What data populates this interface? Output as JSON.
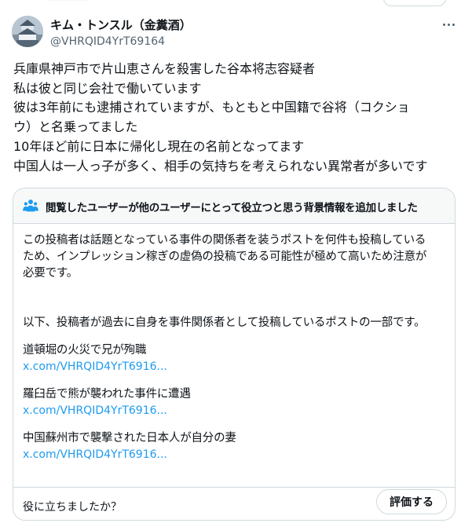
{
  "author": {
    "display_name": "キム・トンスル（金糞酒）",
    "handle": "@VHRQID4YrT69164"
  },
  "tweet": {
    "lines": [
      "兵庫県神戸市で片山恵さんを殺害した谷本将志容疑者",
      "私は彼と同じ会社で働いています",
      "彼は3年前にも逮捕されていますが、もともと中国籍で谷将（コクショ",
      "ウ）と名乗ってました",
      "10年ほど前に日本に帰化し現在の名前となってます",
      "中国人は一人っ子が多く、相手の気持ちを考えられない異常者が多いです"
    ]
  },
  "community_note": {
    "header": "閲覧したユーザーが他のユーザーにとって役立つと思う背景情報を追加しました",
    "body_lines": [
      "この投稿者は話題となっている事件の関係者を装うポストを何件も投稿している",
      "ため、インプレッション稼ぎの虚偽の投稿である可能性が極めて高いため注意が",
      "必要です。"
    ],
    "intro": "以下、投稿者が過去に自身を事件関係者として投稿しているポストの一部です。",
    "examples": [
      {
        "text": "道頓堀の火災で兄が殉職",
        "link": "x.com/VHRQID4YrT6916..."
      },
      {
        "text": "羅臼岳で熊が襲われた事件に遭遇",
        "link": "x.com/VHRQID4YrT6916..."
      },
      {
        "text": "中国蘇州市で襲撃された日本人が自分の妻",
        "link": "x.com/VHRQID4YrT6916..."
      }
    ],
    "helpful_question": "役に立ちましたか？",
    "rate_button": "評価する"
  },
  "icons": {
    "more": "more-horizontal-icon",
    "community": "people-icon",
    "accent": "#1d9bf0"
  }
}
